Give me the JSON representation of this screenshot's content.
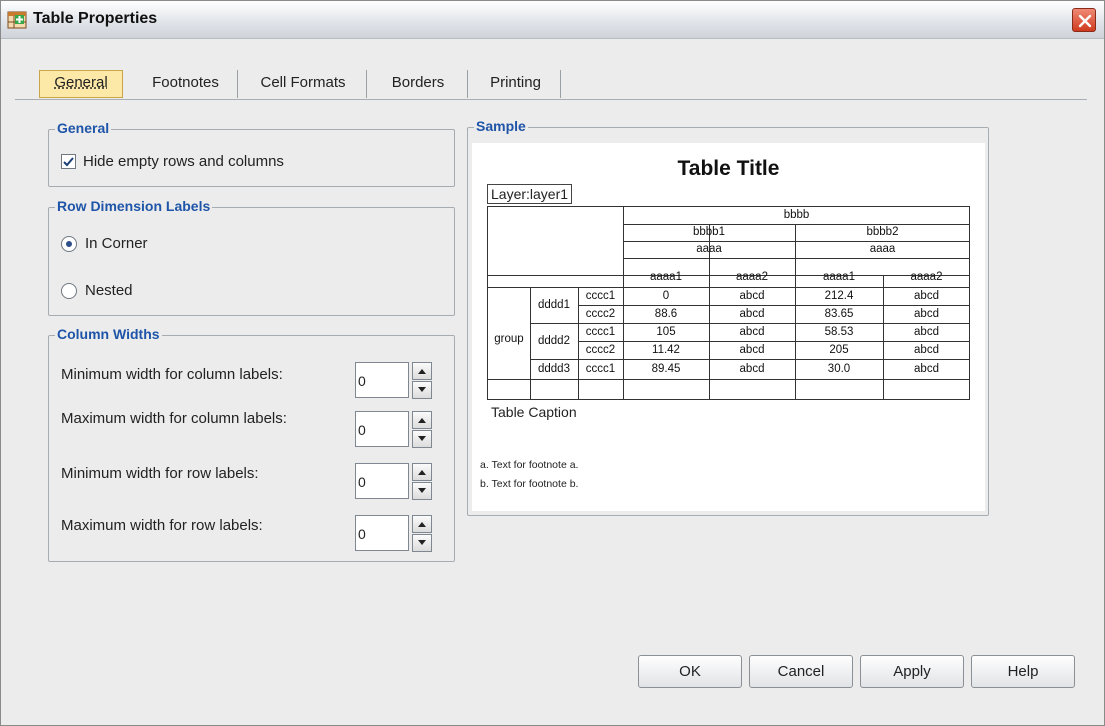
{
  "window": {
    "title": "Table Properties"
  },
  "tabs": [
    "General",
    "Footnotes",
    "Cell Formats",
    "Borders",
    "Printing"
  ],
  "general": {
    "legend": "General",
    "hide_empty_label": "Hide empty rows and columns",
    "hide_empty_checked": true
  },
  "row_labels": {
    "legend": "Row Dimension Labels",
    "options": [
      {
        "label": "In Corner",
        "selected": true
      },
      {
        "label": "Nested",
        "selected": false
      }
    ]
  },
  "column_widths": {
    "legend": "Column Widths",
    "fields": [
      {
        "label": "Minimum width for column labels:",
        "value": "0"
      },
      {
        "label": "Maximum width for column labels:",
        "value": "0"
      },
      {
        "label": "Minimum width for row labels:",
        "value": "0"
      },
      {
        "label": "Maximum width for row labels:",
        "value": "0"
      }
    ]
  },
  "sample": {
    "legend": "Sample",
    "title": "Table Title",
    "layer": "Layer:layer1",
    "header": {
      "top": "bbbb",
      "sub": [
        "bbbb1",
        "bbbb2"
      ],
      "aaaa": [
        "aaaa",
        "aaaa"
      ],
      "leaf": [
        "aaaa1",
        "aaaa2",
        "aaaa1",
        "aaaa2"
      ]
    },
    "group_label": "group",
    "row_groups": [
      "dddd1",
      "dddd2",
      "dddd3"
    ],
    "rows": [
      {
        "c": "cccc1",
        "values": [
          "0",
          "abcd",
          "212.4",
          "abcd"
        ]
      },
      {
        "c": "cccc2",
        "values": [
          "88.6",
          "abcd",
          "83.65",
          "abcd"
        ]
      },
      {
        "c": "cccc1",
        "values": [
          "105",
          "abcd",
          "58.53",
          "abcd"
        ]
      },
      {
        "c": "cccc2",
        "values": [
          "11.42",
          "abcd",
          "205",
          "abcd"
        ]
      },
      {
        "c": "cccc1",
        "values": [
          "89.45",
          "abcd",
          "30.0",
          "abcd"
        ]
      }
    ],
    "caption": "Table Caption",
    "footnotes": [
      "a. Text for footnote a.",
      "b. Text for footnote b."
    ]
  },
  "buttons": {
    "ok": "OK",
    "cancel": "Cancel",
    "apply": "Apply",
    "help": "Help"
  },
  "colors": {
    "accent": "#1f55a8",
    "active_tab": "#fce9a8",
    "close": "#cf3a1d"
  }
}
